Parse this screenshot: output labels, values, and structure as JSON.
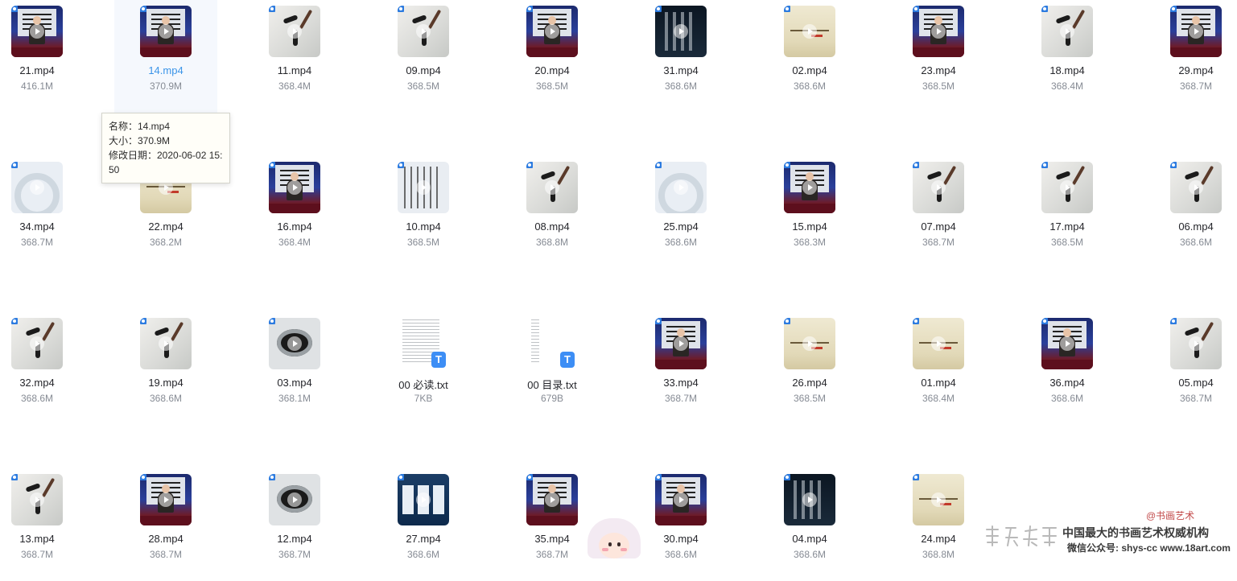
{
  "files": [
    {
      "name": "21.mp4",
      "size": "416.1M",
      "thumb": "studio"
    },
    {
      "name": "14.mp4",
      "size": "370.9M",
      "thumb": "studio",
      "selected": true
    },
    {
      "name": "11.mp4",
      "size": "368.4M",
      "thumb": "paper"
    },
    {
      "name": "09.mp4",
      "size": "368.5M",
      "thumb": "paper"
    },
    {
      "name": "20.mp4",
      "size": "368.5M",
      "thumb": "studio"
    },
    {
      "name": "31.mp4",
      "size": "368.6M",
      "thumb": "dark"
    },
    {
      "name": "02.mp4",
      "size": "368.6M",
      "thumb": "beige"
    },
    {
      "name": "23.mp4",
      "size": "368.5M",
      "thumb": "studio"
    },
    {
      "name": "18.mp4",
      "size": "368.4M",
      "thumb": "paper"
    },
    {
      "name": "29.mp4",
      "size": "368.7M",
      "thumb": "studio"
    },
    {
      "name": "34.mp4",
      "size": "368.7M",
      "thumb": "fan"
    },
    {
      "name": "22.mp4",
      "size": "368.2M",
      "thumb": "beige"
    },
    {
      "name": "16.mp4",
      "size": "368.4M",
      "thumb": "studio"
    },
    {
      "name": "10.mp4",
      "size": "368.5M",
      "thumb": "chart"
    },
    {
      "name": "08.mp4",
      "size": "368.8M",
      "thumb": "paper"
    },
    {
      "name": "25.mp4",
      "size": "368.6M",
      "thumb": "fan"
    },
    {
      "name": "15.mp4",
      "size": "368.3M",
      "thumb": "studio"
    },
    {
      "name": "07.mp4",
      "size": "368.7M",
      "thumb": "paper"
    },
    {
      "name": "17.mp4",
      "size": "368.5M",
      "thumb": "paper"
    },
    {
      "name": "06.mp4",
      "size": "368.6M",
      "thumb": "paper"
    },
    {
      "name": "32.mp4",
      "size": "368.6M",
      "thumb": "paper"
    },
    {
      "name": "19.mp4",
      "size": "368.6M",
      "thumb": "paper"
    },
    {
      "name": "03.mp4",
      "size": "368.1M",
      "thumb": "ink"
    },
    {
      "name": "00 必读.txt",
      "size": "7KB",
      "thumb": "doc"
    },
    {
      "name": "00 目录.txt",
      "size": "679B",
      "thumb": "doc-short"
    },
    {
      "name": "33.mp4",
      "size": "368.7M",
      "thumb": "studio"
    },
    {
      "name": "26.mp4",
      "size": "368.5M",
      "thumb": "beige"
    },
    {
      "name": "01.mp4",
      "size": "368.4M",
      "thumb": "beige"
    },
    {
      "name": "36.mp4",
      "size": "368.6M",
      "thumb": "studio"
    },
    {
      "name": "05.mp4",
      "size": "368.7M",
      "thumb": "paper"
    },
    {
      "name": "13.mp4",
      "size": "368.7M",
      "thumb": "paper"
    },
    {
      "name": "28.mp4",
      "size": "368.7M",
      "thumb": "studio"
    },
    {
      "name": "12.mp4",
      "size": "368.7M",
      "thumb": "ink"
    },
    {
      "name": "27.mp4",
      "size": "368.6M",
      "thumb": "blue"
    },
    {
      "name": "35.mp4",
      "size": "368.7M",
      "thumb": "studio"
    },
    {
      "name": "30.mp4",
      "size": "368.6M",
      "thumb": "studio"
    },
    {
      "name": "04.mp4",
      "size": "368.6M",
      "thumb": "dark"
    },
    {
      "name": "24.mp4",
      "size": "368.8M",
      "thumb": "beige"
    }
  ],
  "txt_badge": "T",
  "tooltip": {
    "name_line": "名称：14.mp4",
    "size_line": "大小：370.9M",
    "date_line": "修改日期：2020-06-02 15:50"
  },
  "watermark": {
    "weibo": "@书画艺术",
    "logo": "书画艺术",
    "slogan": "中国最大的书画艺术权威机构",
    "contact": "微信公众号: shys-cc  www.18art.com"
  },
  "colors": {
    "selected_text": "#3a94e8",
    "selected_bg": "#f5f8fd",
    "badge": "#3d8ef5"
  }
}
